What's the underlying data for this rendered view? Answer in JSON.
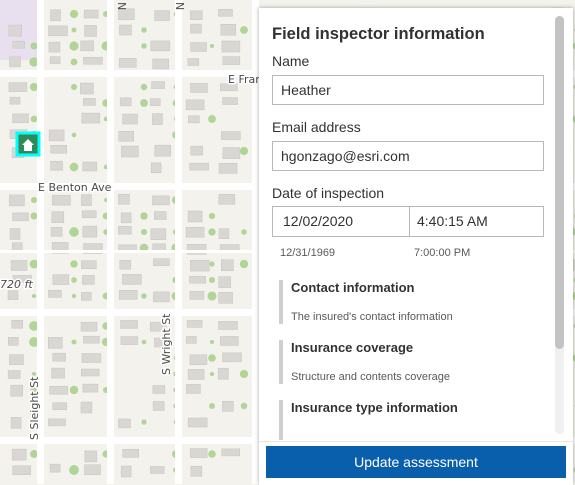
{
  "map": {
    "street_labels": {
      "benton": "E Benton Ave",
      "franklin": "E Fran",
      "wright": "S Wright St",
      "sleight": "S Sleight St",
      "scale": "720 ft"
    },
    "selected_feature_icon": "house-icon",
    "colors": {
      "background": "#f3f2ec",
      "road": "#ffffff",
      "building": "#d9d7d3",
      "tree": "#a9d18e",
      "selection": "#00ffff"
    }
  },
  "panel": {
    "title": "Field inspector information",
    "name": {
      "label": "Name",
      "value": "Heather"
    },
    "email": {
      "label": "Email address",
      "value": "hgonzago@esri.com"
    },
    "inspection_date": {
      "label": "Date of inspection",
      "date_value": "12/02/2020",
      "time_value": "4:40:15 AM",
      "date_hint": "12/31/1969",
      "time_hint": "7:00:00 PM"
    },
    "groups": [
      {
        "title": "Contact information",
        "description": "The insured's contact information"
      },
      {
        "title": "Insurance coverage",
        "description": "Structure and contents coverage"
      },
      {
        "title": "Insurance type information",
        "description": ""
      }
    ],
    "scroll_position": 0.0
  },
  "footer": {
    "update_label": "Update assessment",
    "accent_color": "#0a5fad"
  }
}
